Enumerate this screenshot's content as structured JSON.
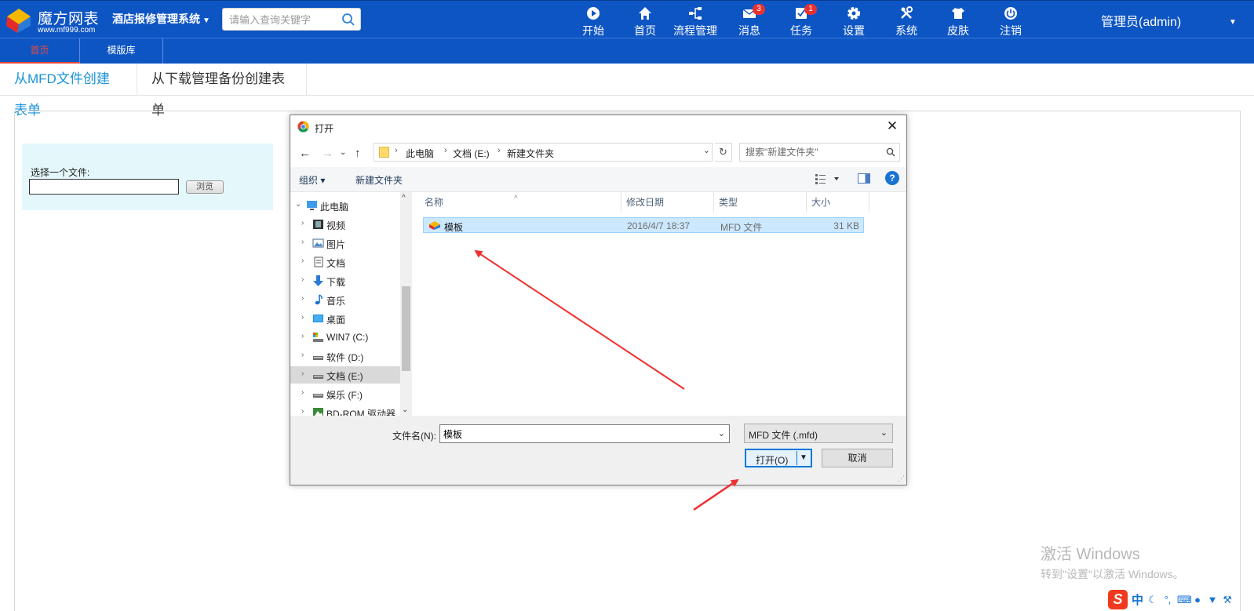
{
  "header": {
    "logo_name": "魔方网表",
    "logo_url": "www.mf999.com",
    "system_title": "酒店报修管理系统",
    "search_placeholder": "请输入查询关键字",
    "nav": [
      {
        "label": "开始",
        "icon": "play-circle-icon"
      },
      {
        "label": "首页",
        "icon": "home-icon"
      },
      {
        "label": "流程管理",
        "icon": "workflow-icon"
      },
      {
        "label": "消息",
        "icon": "mail-icon",
        "badge": "3"
      },
      {
        "label": "任务",
        "icon": "task-icon",
        "badge": "1"
      },
      {
        "label": "设置",
        "icon": "gear-icon"
      },
      {
        "label": "系统",
        "icon": "tools-icon"
      },
      {
        "label": "皮肤",
        "icon": "tshirt-icon"
      },
      {
        "label": "注销",
        "icon": "power-icon"
      }
    ],
    "user": "管理员(admin)"
  },
  "tabs": [
    {
      "label": "首页",
      "active": true
    },
    {
      "label": "模版库",
      "active": false
    }
  ],
  "subtabs": [
    {
      "label": "从MFD文件创建表单",
      "active": true
    },
    {
      "label": "从下载管理备份创建表单",
      "active": false
    }
  ],
  "upload": {
    "label": "选择一个文件:",
    "browse": "浏览"
  },
  "dialog": {
    "title": "打开",
    "breadcrumbs": [
      "此电脑",
      "文档 (E:)",
      "新建文件夹"
    ],
    "search_placeholder": "搜索\"新建文件夹\"",
    "toolbar": {
      "organize": "组织 ▾",
      "new_folder": "新建文件夹",
      "help": "?"
    },
    "tree": [
      {
        "label": "此电脑",
        "icon": "computer-icon",
        "level": 0,
        "expanded": true
      },
      {
        "label": "视频",
        "icon": "video-folder-icon",
        "level": 1
      },
      {
        "label": "图片",
        "icon": "picture-folder-icon",
        "level": 1
      },
      {
        "label": "文档",
        "icon": "document-folder-icon",
        "level": 1
      },
      {
        "label": "下载",
        "icon": "download-folder-icon",
        "level": 1
      },
      {
        "label": "音乐",
        "icon": "music-folder-icon",
        "level": 1
      },
      {
        "label": "桌面",
        "icon": "desktop-folder-icon",
        "level": 1
      },
      {
        "label": "WIN7 (C:)",
        "icon": "system-drive-icon",
        "level": 1
      },
      {
        "label": "软件 (D:)",
        "icon": "drive-icon",
        "level": 1
      },
      {
        "label": "文档 (E:)",
        "icon": "drive-icon",
        "level": 1,
        "selected": true
      },
      {
        "label": "娱乐 (F:)",
        "icon": "drive-icon",
        "level": 1
      },
      {
        "label": "BD-ROM 驱动器",
        "icon": "optical-drive-icon",
        "level": 1
      }
    ],
    "columns": [
      "名称",
      "修改日期",
      "类型",
      "大小"
    ],
    "files": [
      {
        "name": "模板",
        "modified": "2016/4/7 18:37",
        "type": "MFD 文件",
        "size": "31 KB"
      }
    ],
    "filename_label": "文件名(N):",
    "filename_value": "模板",
    "filetype": "MFD 文件 (.mfd)",
    "open_label": "打开(O)",
    "cancel_label": "取消"
  },
  "watermark": {
    "line1": "激活 Windows",
    "line2": "转到\"设置\"以激活 Windows。"
  },
  "ime": {
    "logo": "S",
    "mode": "中"
  },
  "colors": {
    "header_bg": "#0e55c4",
    "active_subtab": "#1a93d9",
    "active_tab": "#e84a3a",
    "selection": "#cce8ff",
    "annotation_arrow": "#ee3030"
  }
}
